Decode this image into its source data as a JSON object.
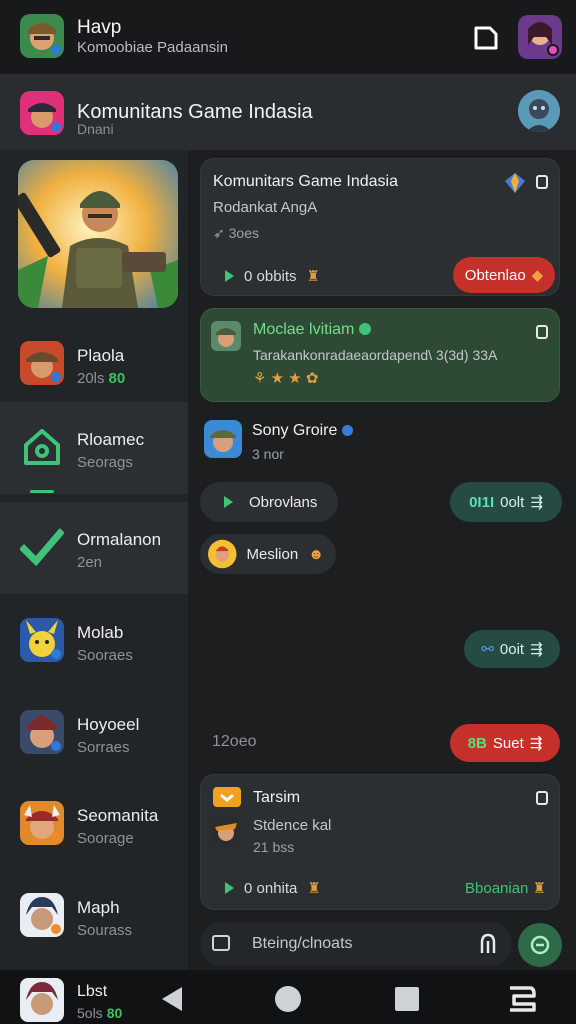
{
  "topbar": {
    "title": "Havp",
    "subtitle": "Komoobiae Padaansin"
  },
  "community": {
    "title": "Komunitans Game Indasia",
    "subtitle": "Dnani"
  },
  "sidebar": {
    "items": [
      {
        "title": "Plaola",
        "sub": "20ls",
        "badge": "80",
        "icon": "soldier-hat-icon"
      },
      {
        "title": "Rloamec",
        "sub": "Seorags",
        "icon": "home-icon"
      },
      {
        "title": "Ormalanon",
        "sub": "2en",
        "icon": "check-icon"
      },
      {
        "title": "Molab",
        "sub": "Sooraes",
        "icon": "pikachu-icon"
      },
      {
        "title": "Hoyoeel",
        "sub": "Sorraes",
        "icon": "warrior-icon"
      },
      {
        "title": "Seomanita",
        "sub": "Soorage",
        "icon": "viking-icon"
      },
      {
        "title": "Maph",
        "sub": "Sourass",
        "icon": "samurai-icon"
      }
    ]
  },
  "feed": {
    "card1": {
      "title": "Komunitars Game Indasia",
      "sub": "Rodankat AngA",
      "meta": "3oes",
      "left_action": "0 obbits",
      "right_action": "Obtenlao"
    },
    "card2": {
      "title": "Moclae lvitiam",
      "sub": "Tarakankonradaeaordapend\\ 3(3d) 33A"
    },
    "row1": {
      "title": "Sony Groire",
      "sub": "3 nor"
    },
    "btn_left": "Obrovlans",
    "btn_right_num": "0I1I",
    "btn_right": "0olt",
    "mention": "Meslion",
    "btn_right2": "0oit",
    "timestamp": "12oeo",
    "btn_red_num": "8B",
    "btn_red": "Suet",
    "card3": {
      "title": "Tarsim",
      "sub": "Stdence kal",
      "meta": "21 bss",
      "left_action": "0 onhita",
      "right_action": "Bboanian"
    }
  },
  "composer": {
    "placeholder": "Bteing/clnoats"
  },
  "navbar": {
    "title": "Lbst",
    "sub": "5ols",
    "badge": "80"
  },
  "colors": {
    "accent_green": "#3fc27a",
    "danger_red": "#c5302a",
    "teal_pill": "#264a44"
  }
}
